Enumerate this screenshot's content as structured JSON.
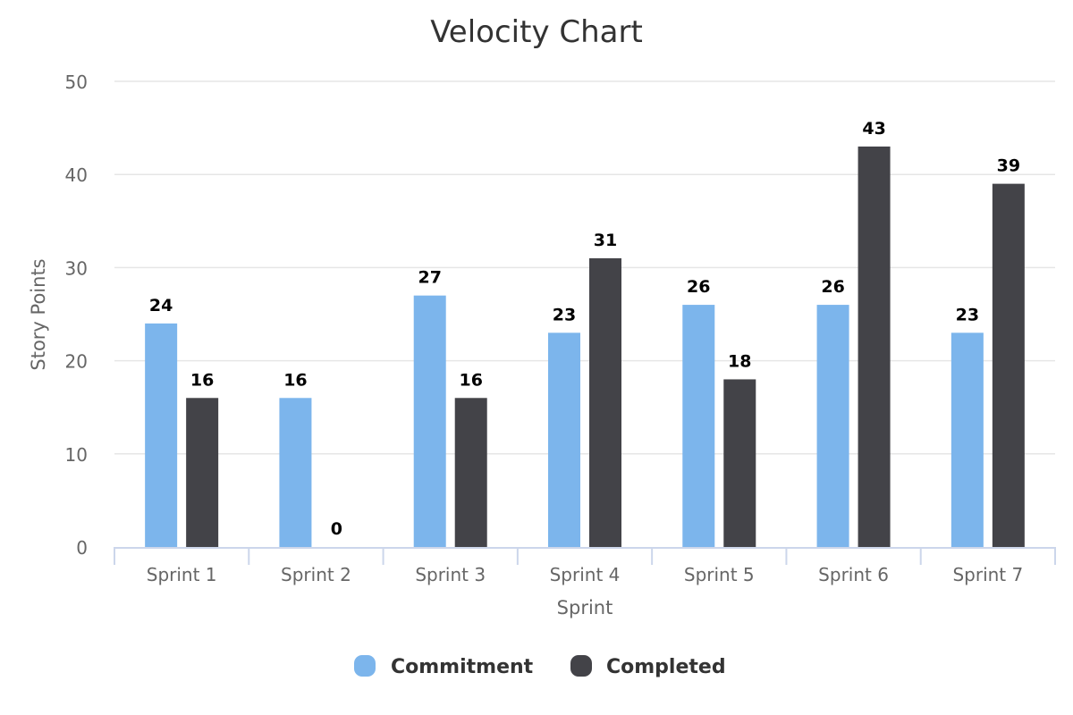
{
  "chart_data": {
    "type": "bar",
    "title": "Velocity Chart",
    "xlabel": "Sprint",
    "ylabel": "Story Points",
    "categories": [
      "Sprint 1",
      "Sprint 2",
      "Sprint 3",
      "Sprint 4",
      "Sprint 5",
      "Sprint 6",
      "Sprint 7"
    ],
    "series": [
      {
        "name": "Commitment",
        "color": "#7cb5ec",
        "values": [
          24,
          16,
          27,
          23,
          26,
          26,
          23
        ]
      },
      {
        "name": "Completed",
        "color": "#434348",
        "values": [
          16,
          0,
          16,
          31,
          18,
          43,
          39
        ]
      }
    ],
    "ylim": [
      0,
      50
    ],
    "yticks": [
      0,
      10,
      20,
      30,
      40,
      50
    ],
    "grid": true,
    "data_labels": true,
    "legend": "bottom-center",
    "colors": {
      "title": "#333333",
      "tick": "#666666",
      "grid": "#e6e6e6",
      "axis": "#ccd6eb",
      "data_label": "#000000"
    }
  }
}
